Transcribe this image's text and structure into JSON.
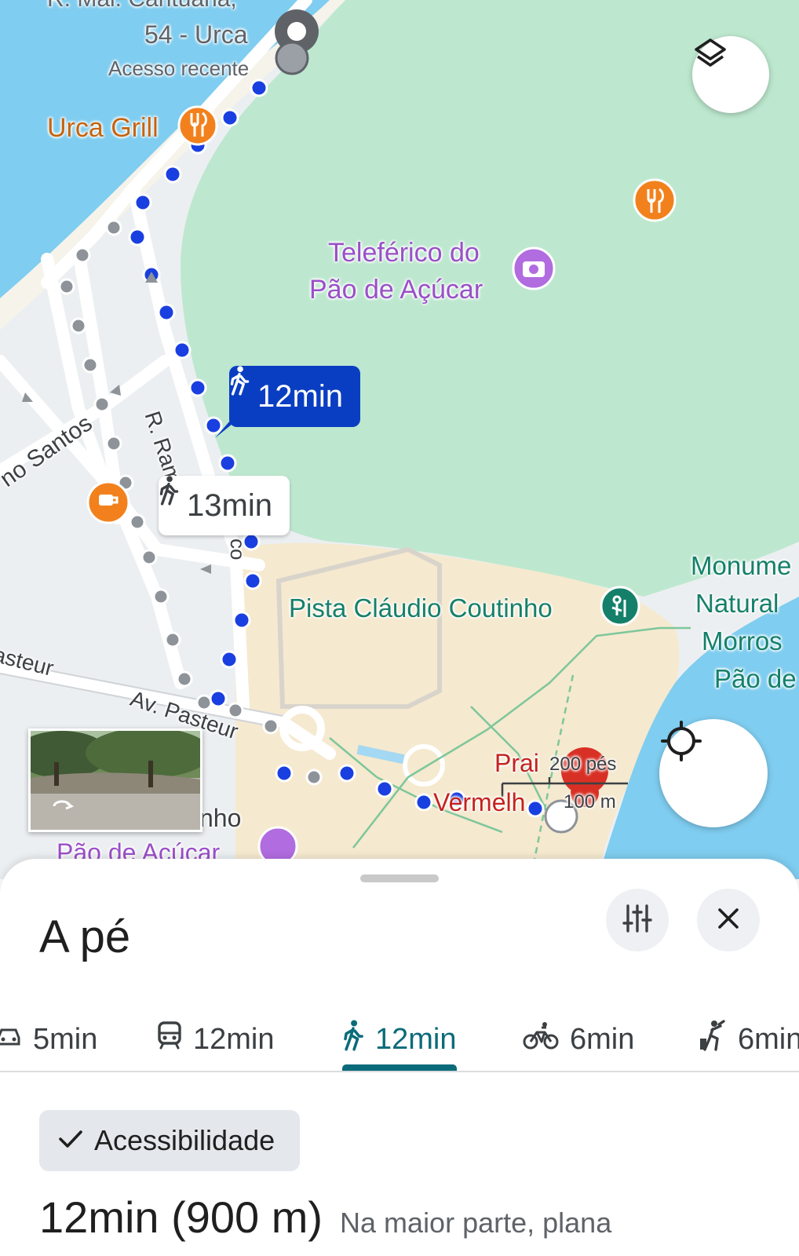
{
  "map": {
    "labels": {
      "top_cut": "R. Mal. Cantuária,",
      "address": "54 - Urca",
      "recent": "Acesso recente",
      "urca_grill": "Urca Grill",
      "teleferico_1": "Teleférico do",
      "teleferico_2": "Pão de Açúcar",
      "street_ramon": "R. Ramon",
      "street_co": "co",
      "street_santos": "no Santos",
      "pista": "Pista Cláudio Coutinho",
      "monumento_1": "Monume",
      "monumento_2": "Natural",
      "monumento_3": "Morros",
      "monumento_4": "Pão de",
      "av_pasteur": "Av. Pasteur",
      "pasteur_left": "asteur",
      "praia_1": "Prai",
      "praia_2": "Vermelh",
      "nho": "nho",
      "pao_bottom": "Pão de Açúcar",
      "scale_ft": "200 pés",
      "scale_m": "100 m"
    },
    "callout_primary": "12min",
    "callout_alt": "13min",
    "icons": {
      "layers": "layers-icon",
      "locate": "my-location-icon",
      "restaurant": "restaurant-icon",
      "camera": "camera-icon",
      "cafe": "cafe-icon",
      "hiking": "hiking-icon",
      "walk": "walk-icon"
    },
    "colors": {
      "water": "#7fcdf0",
      "park": "#bde8cf",
      "sand": "#f5e9cf",
      "route_blue": "#1a3fe0",
      "route_alt": "#9aa0a6",
      "callout_bg": "#0a3ec2",
      "poi_orange": "#f2811d",
      "poi_purple": "#b16ce0",
      "poi_teal": "#15806a",
      "pin_red": "#d93025"
    }
  },
  "sheet": {
    "title": "A pé",
    "tabs": [
      {
        "icon": "car-icon",
        "label": "5min"
      },
      {
        "icon": "transit-icon",
        "label": "12min"
      },
      {
        "icon": "walk-icon",
        "label": "12min",
        "active": true
      },
      {
        "icon": "bike-icon",
        "label": "6min"
      },
      {
        "icon": "ride-icon",
        "label": "6min"
      }
    ],
    "chip": "Acessibilidade",
    "duration": "12min (900 m)",
    "description": "Na maior parte, plana",
    "colors": {
      "accent": "#0b6b7a"
    }
  }
}
